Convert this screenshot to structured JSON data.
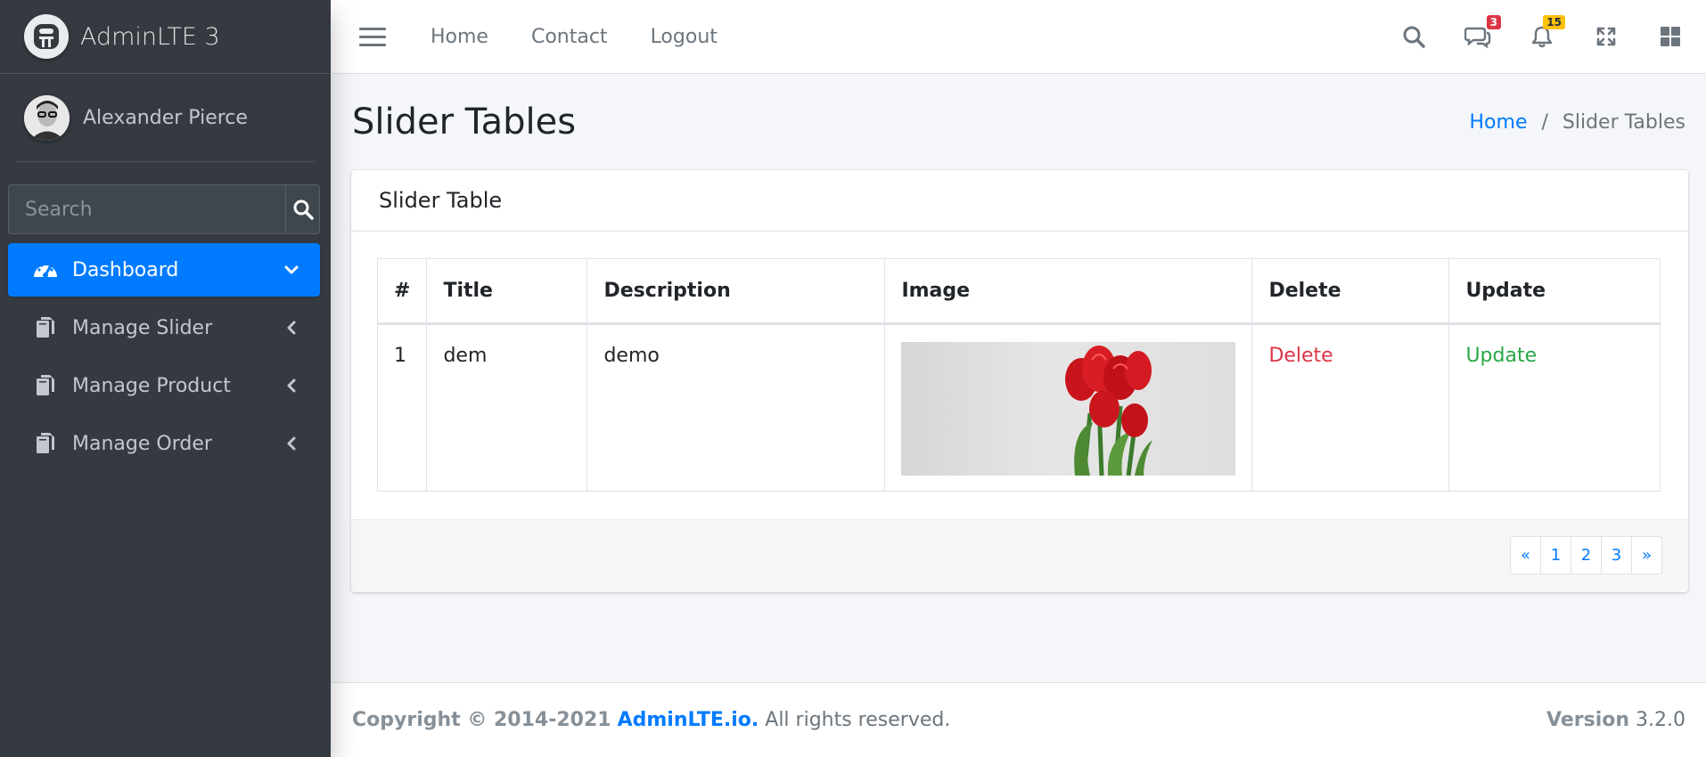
{
  "brand": {
    "name": "AdminLTE 3",
    "logo_icon": "adminlte-logo-icon"
  },
  "user": {
    "name": "Alexander Pierce"
  },
  "search": {
    "placeholder": "Search"
  },
  "sidebar": {
    "items": [
      {
        "label": "Dashboard",
        "icon": "tachometer-icon",
        "active": true
      },
      {
        "label": "Manage Slider",
        "icon": "copy-icon",
        "active": false
      },
      {
        "label": "Manage Product",
        "icon": "copy-icon",
        "active": false
      },
      {
        "label": "Manage Order",
        "icon": "copy-icon",
        "active": false
      }
    ]
  },
  "topbar": {
    "links": [
      "Home",
      "Contact",
      "Logout"
    ],
    "messages_badge": "3",
    "notifications_badge": "15"
  },
  "header": {
    "title": "Slider Tables",
    "breadcrumb": {
      "home": "Home",
      "separator": "/",
      "current": "Slider Tables"
    }
  },
  "card": {
    "title": "Slider Table",
    "table": {
      "headers": [
        "#",
        "Title",
        "Description",
        "Image",
        "Delete",
        "Update"
      ],
      "rows": [
        {
          "num": "1",
          "title": "dem",
          "description": "demo",
          "image": "red-tulips-image",
          "delete": "Delete",
          "update": "Update"
        }
      ]
    },
    "pagination": [
      "«",
      "1",
      "2",
      "3",
      "»"
    ]
  },
  "footer": {
    "copyright": "Copyright © 2014-2021",
    "link": "AdminLTE.io.",
    "rights": "All rights reserved.",
    "version_label": "Version",
    "version": "3.2.0"
  },
  "colors": {
    "primary": "#007bff",
    "sidebar_bg": "#343a40",
    "danger": "#dc3545",
    "success": "#28a745",
    "warning": "#ffc107"
  }
}
